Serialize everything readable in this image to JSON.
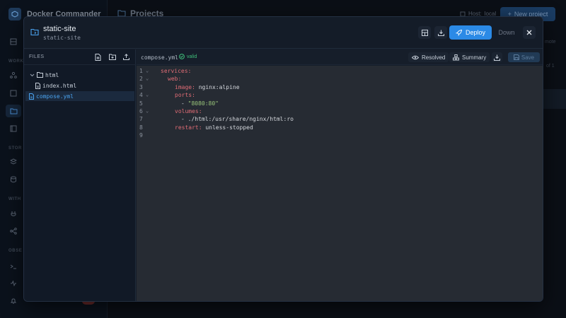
{
  "app": {
    "name": "Docker Commander",
    "page_title": "Projects",
    "host_label": "Host:",
    "host_value": "local",
    "new_project_label": "New project",
    "bg_fragment_1": "mote",
    "bg_fragment_2": "of 1"
  },
  "sidebar": {
    "sections": [
      "WORK",
      "STOR",
      "WITH",
      "OBSE"
    ],
    "icons": [
      "grid-icon",
      "network-icon",
      "images-icon",
      "projects-icon",
      "container-icon",
      "layers-icon",
      "database-icon",
      "plug-icon",
      "share-icon",
      "terminal-icon",
      "activity-icon",
      "bell-icon"
    ],
    "bell_badge_label": "Alerts"
  },
  "modal": {
    "title": "static-site",
    "subtitle": "static-site",
    "deploy_label": "Deploy",
    "down_label": "Down",
    "accent": "#2b8ae6"
  },
  "files": {
    "title": "FILES",
    "tree": [
      {
        "label": "html",
        "type": "folder",
        "depth": 0
      },
      {
        "label": "index.html",
        "type": "file",
        "depth": 1
      },
      {
        "label": "compose.yml",
        "type": "file",
        "depth": 0,
        "selected": true
      }
    ]
  },
  "editor": {
    "filename": "compose.yml",
    "status": "valid",
    "resolved_label": "Resolved",
    "summary_label": "Summary",
    "save_label": "Save",
    "lines": [
      {
        "n": "1",
        "fold": true
      },
      {
        "n": "2",
        "fold": true
      },
      {
        "n": "3",
        "fold": false
      },
      {
        "n": "4",
        "fold": true
      },
      {
        "n": "5",
        "fold": false
      },
      {
        "n": "6",
        "fold": true
      },
      {
        "n": "7",
        "fold": false
      },
      {
        "n": "8",
        "fold": false
      },
      {
        "n": "9",
        "fold": false
      }
    ],
    "code": {
      "l1_key": "services:",
      "l2_key": "web:",
      "l3_key": "image:",
      "l3_val": " nginx:alpine",
      "l4_key": "ports:",
      "l5_dash": "- ",
      "l5_val": "\"8080:80\"",
      "l6_key": "volumes:",
      "l7_dash": "- ",
      "l7_val": "./html:/usr/share/nginx/html:ro",
      "l8_key": "restart:",
      "l8_val": " unless-stopped"
    }
  }
}
